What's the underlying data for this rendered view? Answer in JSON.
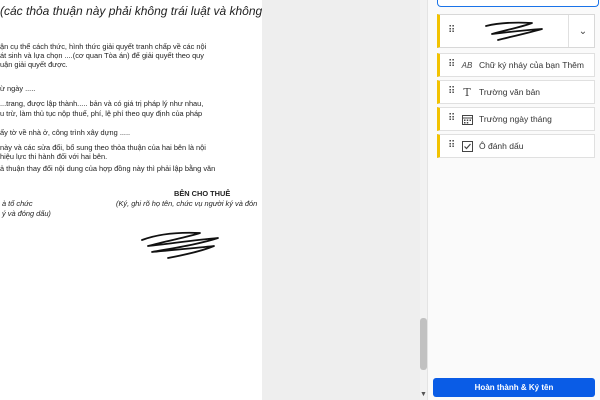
{
  "document": {
    "heading": "(các thỏa thuận này phải không trái luật và không",
    "lines": [
      "ận cụ thể cách thức, hình thức giải quyết tranh chấp về các nội",
      "át sinh và lựa chọn ....(cơ quan Tòa án) để giải quyết theo quy",
      "uận giải quyết được.",
      "ừ ngày .....",
      "...trang, được lập thành..... bản và có giá trị pháp lý như nhau,",
      "u trừ, làm thủ tục nộp thuế, phí, lệ phí theo quy định của pháp",
      "ấy tờ về nhà ở, công trình xây dựng .....",
      "này và các sửa đổi, bổ sung theo thỏa thuận của hai bên là nội",
      "hiệu lực thi hành đối với hai bên.",
      "ả thuận thay đổi nội dung của hợp đồng này thì phải lập bằng văn"
    ],
    "left_sig_line1": "à tổ chức",
    "left_sig_line2": "ý và đóng dấu)",
    "lessor_title": "BÊN CHO THUÊ",
    "lessor_note": "(Ký, ghi rõ họ tên, chức vụ người ký và đón"
  },
  "panel": {
    "fields": [
      {
        "icon": "initials-icon",
        "glyph": "AB",
        "label": "Chữ ký nháy của bạn",
        "action": "Thêm"
      },
      {
        "icon": "text-field-icon",
        "glyph": "T",
        "label": "Trường văn bản",
        "action": ""
      },
      {
        "icon": "calendar-icon",
        "glyph": "",
        "label": "Trường ngày tháng",
        "action": ""
      },
      {
        "icon": "checkbox-icon",
        "glyph": "",
        "label": "Ô đánh dấu",
        "action": ""
      }
    ],
    "finish_label": "Hoàn thành & Ký tên"
  },
  "colors": {
    "accent": "#0a5ce6",
    "field_marker": "#f2c200",
    "top_outline": "#1a73e8"
  }
}
